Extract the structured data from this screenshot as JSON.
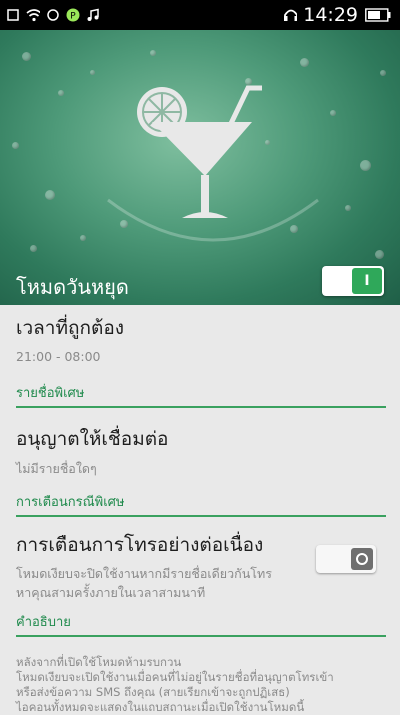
{
  "status_bar": {
    "time": "14:29"
  },
  "hero": {
    "title": "โหมดวันหยุด",
    "toggle_state": "on",
    "toggle_symbol": "I"
  },
  "time_row": {
    "title": "เวลาที่ถูกต้อง",
    "value": "21:00 - 08:00"
  },
  "section_special_list": {
    "label": "รายชื่อพิเศษ"
  },
  "allow_connect": {
    "title": "อนุญาตให้เชื่อมต่อ",
    "value": "ไม่มีรายชื่อใดๆ"
  },
  "section_special_alert": {
    "label": "การเตือนกรณีพิเศษ"
  },
  "repeat_call": {
    "title": "การเตือนการโทรอย่างต่อเนื่อง",
    "desc_line1": "โหมดเงียบจะปิดใช้งานหากมีรายชื่อเดียวกันโทร",
    "desc_line2": "หาคุณสามครั้งภายในเวลาสามนาที",
    "toggle_state": "off"
  },
  "section_description": {
    "label": "คำอธิบาย"
  },
  "description": {
    "line1": "หลังจากที่เปิดใช้โหมดห้ามรบกวน",
    "line2": "โหมดเงียบจะเปิดใช้งานเมื่อคนที่ไม่อยู่ในรายชื่อที่อนุญาตโทรเข้า",
    "line3": "หรือส่งข้อความ SMS ถึงคุณ (สายเรียกเข้าจะถูกปฏิเสธ)",
    "line4": "ไอคอนทั้งหมดจะแสดงในแถบสถานะเมื่อเปิดใช้งานโหมดนี้"
  },
  "colors": {
    "accent": "#3aa15f",
    "hero": "#4e9a79"
  }
}
